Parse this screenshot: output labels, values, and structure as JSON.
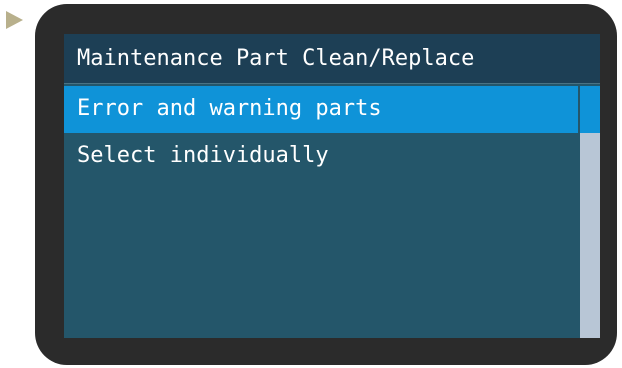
{
  "screen": {
    "title": "Maintenance Part Clean/Replace",
    "menu_items": [
      {
        "label": "Error and warning parts",
        "selected": true
      },
      {
        "label": "Select individually",
        "selected": false
      }
    ],
    "scroll_position": 0.0
  },
  "indicator": {
    "icon": "play-arrow-icon",
    "color": "#b8b08c"
  },
  "colors": {
    "bezel": "#2b2b2b",
    "screen_background": "#24566a",
    "title_bar": "#1d3f55",
    "selection_highlight": "#0f93d8",
    "scrollbar_track": "#b8c6d6",
    "text": "#ffffff"
  }
}
